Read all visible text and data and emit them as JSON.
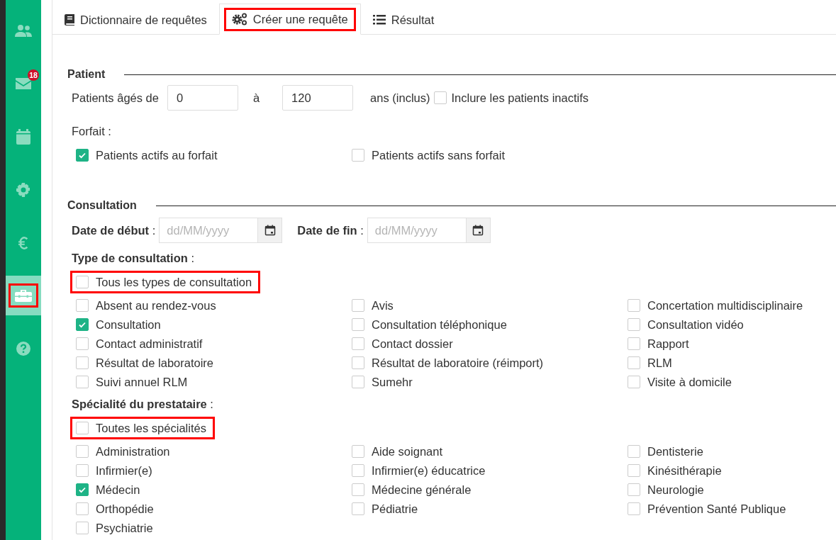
{
  "sidebar": {
    "items": [
      {
        "kind": "users",
        "selected": false,
        "highlighted": false
      },
      {
        "kind": "mail",
        "selected": false,
        "highlighted": false,
        "badge": "18"
      },
      {
        "kind": "calendar",
        "selected": false,
        "highlighted": false
      },
      {
        "kind": "gear",
        "selected": false,
        "highlighted": false
      },
      {
        "kind": "euro",
        "selected": false,
        "highlighted": false
      },
      {
        "kind": "toolbox",
        "selected": true,
        "highlighted": true
      },
      {
        "kind": "help",
        "selected": false,
        "highlighted": false
      }
    ]
  },
  "tabs": [
    {
      "kind": "book",
      "label": "Dictionnaire de requêtes",
      "selected": false,
      "highlighted": false
    },
    {
      "kind": "gears",
      "label": "Créer une requête",
      "selected": true,
      "highlighted": true
    },
    {
      "kind": "list",
      "label": "Résultat",
      "selected": false,
      "highlighted": false
    }
  ],
  "patient": {
    "title": "Patient",
    "age_label": "Patients âgés de",
    "age_from": "0",
    "age_sep": "à",
    "age_to": "120",
    "age_suffix": "ans (inclus)",
    "inactive": {
      "label": "Inclure les patients inactifs",
      "checked": false
    },
    "forfait_label": "Forfait :",
    "forfait_options": [
      {
        "label": "Patients actifs au forfait",
        "checked": true
      },
      {
        "label": "Patients actifs sans forfait",
        "checked": false
      }
    ]
  },
  "consultation": {
    "title": "Consultation",
    "start_label": "**Date de début** :",
    "start_placeholder": "dd/MM/yyyy",
    "end_label": "**Date de fin** :",
    "end_placeholder": "dd/MM/yyyy",
    "groups": [
      {
        "label": "**Type de consultation** :",
        "all": {
          "label": "Tous les types de consultation",
          "checked": false,
          "highlighted": true
        },
        "options": [
          {
            "label": "Absent au rendez-vous",
            "checked": false
          },
          {
            "label": "Avis",
            "checked": false
          },
          {
            "label": "Concertation multidisciplinaire",
            "checked": false
          },
          {
            "label": "Consultation",
            "checked": true
          },
          {
            "label": "Consultation téléphonique",
            "checked": false
          },
          {
            "label": "Consultation vidéo",
            "checked": false
          },
          {
            "label": "Contact administratif",
            "checked": false
          },
          {
            "label": "Contact dossier",
            "checked": false
          },
          {
            "label": "Rapport",
            "checked": false
          },
          {
            "label": "Résultat de laboratoire",
            "checked": false
          },
          {
            "label": "Résultat de laboratoire (réimport)",
            "checked": false
          },
          {
            "label": "RLM",
            "checked": false
          },
          {
            "label": "Suivi annuel RLM",
            "checked": false
          },
          {
            "label": "Sumehr",
            "checked": false
          },
          {
            "label": "Visite à domicile",
            "checked": false
          }
        ]
      },
      {
        "label": "**Spécialité du prestataire** :",
        "all": {
          "label": "Toutes les spécialités",
          "checked": false,
          "highlighted": true
        },
        "options": [
          {
            "label": "Administration",
            "checked": false
          },
          {
            "label": "Aide soignant",
            "checked": false
          },
          {
            "label": "Dentisterie",
            "checked": false
          },
          {
            "label": "Infirmier(e)",
            "checked": false
          },
          {
            "label": "Infirmier(e) éducatrice",
            "checked": false
          },
          {
            "label": "Kinésithérapie",
            "checked": false
          },
          {
            "label": "Médecin",
            "checked": true
          },
          {
            "label": "Médecine générale",
            "checked": false
          },
          {
            "label": "Neurologie",
            "checked": false
          },
          {
            "label": "Orthopédie",
            "checked": false
          },
          {
            "label": "Pédiatrie",
            "checked": false
          },
          {
            "label": "Prévention Santé Publique",
            "checked": false
          },
          {
            "label": "Psychiatrie",
            "checked": false
          }
        ]
      }
    ]
  }
}
